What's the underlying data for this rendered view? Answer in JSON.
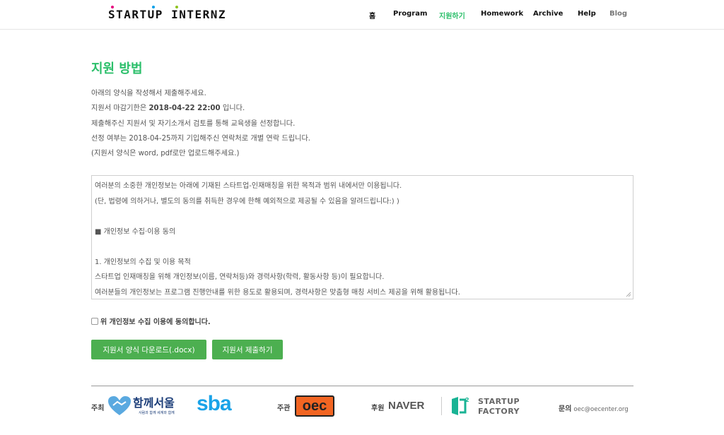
{
  "header": {
    "logo_text": "STARTUP INTERNZ",
    "nav": [
      {
        "label": "홈"
      },
      {
        "label": "Program"
      },
      {
        "label": "지원하기"
      },
      {
        "label": "Homework"
      },
      {
        "label": "Archive"
      },
      {
        "label": "Help"
      },
      {
        "label": "Blog"
      }
    ]
  },
  "main": {
    "title": "지원 방법",
    "desc": {
      "line1": "아래의 양식을 작성해서 제출해주세요.",
      "line2_pre": "지원서 마감기한은 ",
      "line2_date": "2018-04-22 22:00",
      "line2_post": " 입니다.",
      "line3": "제출해주신 지원서 및 자기소개서 검토를 통해 교육생을 선정합니다.",
      "line4": "선정 여부는 2018-04-25까지 기입해주신 연락처로 개별 연락 드립니다.",
      "line5": "(지원서 양식은 word, pdf로만 업로드해주세요.)"
    },
    "terms": [
      "여러분의 소중한 개인정보는 아래에 기재된 스타트업-인재매칭을 위한 목적과 범위 내에서만 이용됩니다.",
      "(단, 법령에 의하거나, 별도의 동의를 취득한 경우에 한해 예외적으로 제공될 수 있음을 알려드립니다:) )",
      "",
      "■ 개인정보 수집·이용 동의",
      "",
      "1. 개인정보의 수집 및 이용 목적",
      "스타트업 인재매칭을 위해 개인정보(이름, 연락처등)와 경력사항(학력, 활동사항 등)이 필요합니다.",
      "여러분들의 개인정보는 프로그램 진행안내를 위한 용도로 활용되며, 경력사항은 맞춤형 매칭 서비스 제공을 위해 활용됩니다."
    ],
    "agree_label": "위 개인정보 수집 이용에 동의합니다.",
    "download_button": "지원서 양식 다운로드(.docx)",
    "submit_button": "지원서 제출하기"
  },
  "footer": {
    "host_label": "주최",
    "host_logo1_text": "함께서울",
    "host_logo1_sub": "사람과 함께 세계와 함께",
    "host_logo2_text": "sba",
    "organizer_label": "주관",
    "organizer_logo_text": "oec",
    "sponsor_label": "후원",
    "sponsor_logo1_text": "NAVER",
    "sponsor_logo2_line1": "STARTUP",
    "sponsor_logo2_line2": "FACTORY",
    "contact_label": "문의",
    "contact_email": "oec@oecenter.org"
  },
  "colors": {
    "accent": "#2bbf6a",
    "button": "#4caf50",
    "naver": "#555555",
    "sba": "#1aa3e8",
    "oec": "#f26522",
    "startup_factory": "#19b394"
  }
}
